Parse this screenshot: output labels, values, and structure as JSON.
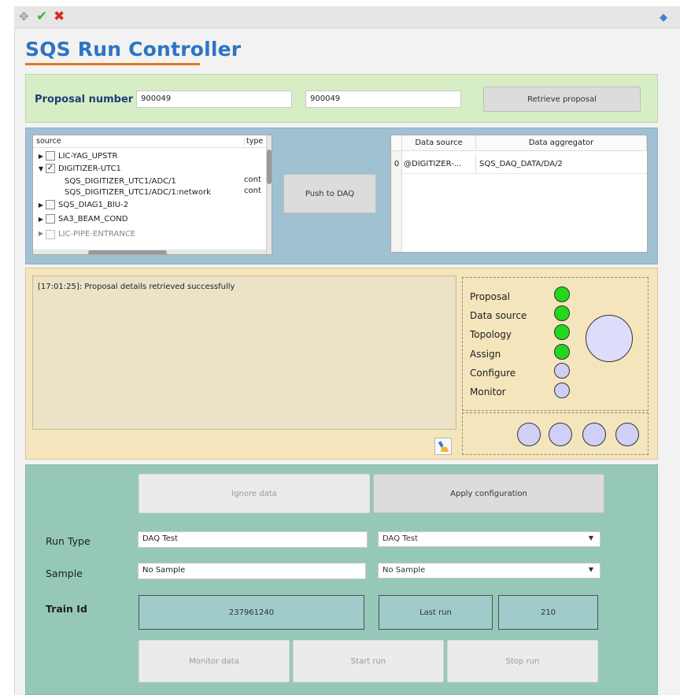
{
  "toolbar": {
    "move_icon": "move-icon",
    "accept_icon": "check-icon",
    "reject_icon": "close-icon",
    "menu_icon": "diamond-icon"
  },
  "app_title": "SQS Run Controller",
  "proposal": {
    "label": "Proposal number",
    "number_value": "900049",
    "number_confirm_value": "900049",
    "retrieve_button": "Retrieve proposal"
  },
  "source_tree": {
    "headers": [
      "source",
      "type"
    ],
    "rows": [
      {
        "label": "LIC-YAG_UPSTR",
        "type": "",
        "expanded": false,
        "checked": false
      },
      {
        "label": "DIGITIZER-UTC1",
        "type": "",
        "expanded": true,
        "checked": true
      },
      {
        "label": "SQS_DIGITIZER_UTC1/ADC/1",
        "type": "cont",
        "child": true
      },
      {
        "label": "SQS_DIGITIZER_UTC1/ADC/1:network",
        "type": "cont",
        "child": true
      },
      {
        "label": "SQS_DIAG1_BIU-2",
        "type": "",
        "expanded": false,
        "checked": false
      },
      {
        "label": "SA3_BEAM_COND",
        "type": "",
        "expanded": false,
        "checked": false
      },
      {
        "label": "LIC-PIPE-ENTRANCE",
        "type": "",
        "expanded": false,
        "checked": false
      }
    ]
  },
  "push_button": "Push to DAQ",
  "data_grid": {
    "headers": [
      "Data source",
      "Data aggregator"
    ],
    "rows": [
      {
        "index": "0",
        "source": "@DIGITIZER-...",
        "aggregator": "SQS_DAQ_DATA/DA/2"
      }
    ]
  },
  "log": {
    "message": "[17:01:25]: Proposal details retrieved successfully"
  },
  "status": {
    "items": [
      {
        "label": "Proposal",
        "state": "on"
      },
      {
        "label": "Data source",
        "state": "on"
      },
      {
        "label": "Topology",
        "state": "on"
      },
      {
        "label": "Assign",
        "state": "on"
      },
      {
        "label": "Configure",
        "state": "off"
      },
      {
        "label": "Monitor",
        "state": "off"
      }
    ],
    "colors": {
      "on": "#23d71e",
      "off": "#cfcff5"
    }
  },
  "controls": {
    "ignore_button": "Ignore data",
    "apply_button": "Apply configuration",
    "run_type_label": "Run Type",
    "run_type_value": "DAQ Test",
    "run_type_select": "DAQ Test",
    "sample_label": "Sample",
    "sample_value": "No Sample",
    "sample_select": "No Sample",
    "train_label": "Train Id",
    "train_value": "237961240",
    "last_run_label": "Last run",
    "last_run_value": "210",
    "monitor_button": "Monitor data",
    "start_button": "Start run",
    "stop_button": "Stop run"
  },
  "colors": {
    "title": "#2d74c4",
    "accent_underline": "#e07a1f",
    "proposal_bg": "#d6edc5",
    "sources_bg": "#9fc1d2",
    "log_bg": "#f4e5bd",
    "control_bg": "#96c8ba"
  }
}
